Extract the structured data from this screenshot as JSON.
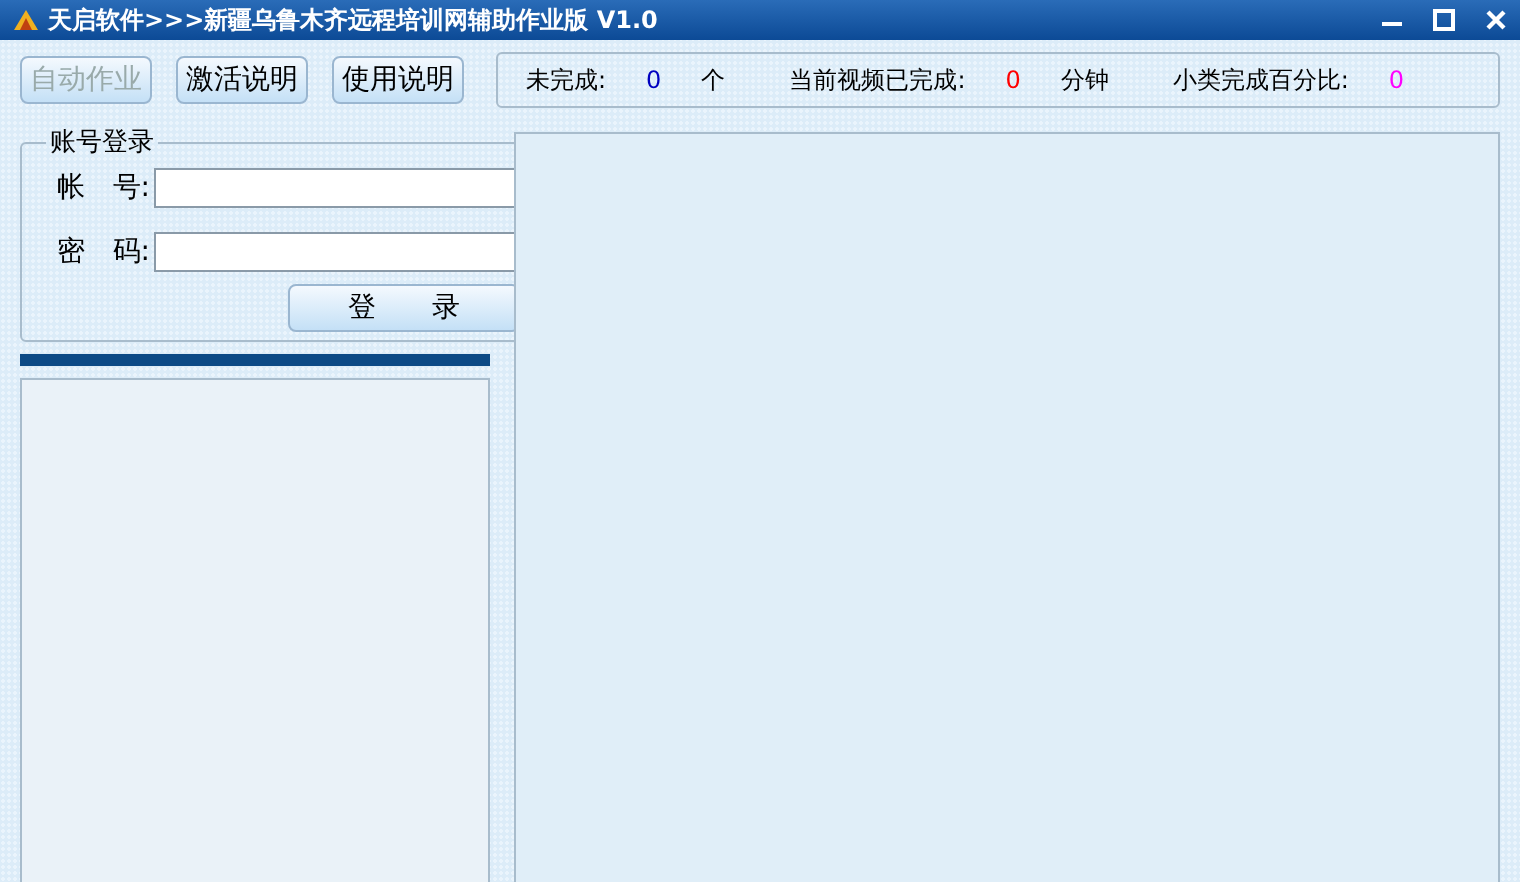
{
  "window": {
    "title": "天启软件>>>新疆乌鲁木齐远程培训网辅助作业版 V1.0"
  },
  "toolbar": [
    {
      "label": "自动作业",
      "disabled": true
    },
    {
      "label": "激活说明",
      "disabled": false
    },
    {
      "label": "使用说明",
      "disabled": false
    }
  ],
  "stats": [
    {
      "label": "未完成:",
      "value": "0",
      "unit": "个",
      "color": "#0000c0"
    },
    {
      "label": "当前视频已完成:",
      "value": "0",
      "unit": "分钟",
      "color": "#ff0000"
    },
    {
      "label": "小类完成百分比:",
      "value": "0",
      "color": "#ff00ff"
    }
  ],
  "login": {
    "title": "账号登录",
    "fields": [
      {
        "label": "帐　号:"
      },
      {
        "label": "密　码:"
      }
    ],
    "button": "登　　录"
  }
}
